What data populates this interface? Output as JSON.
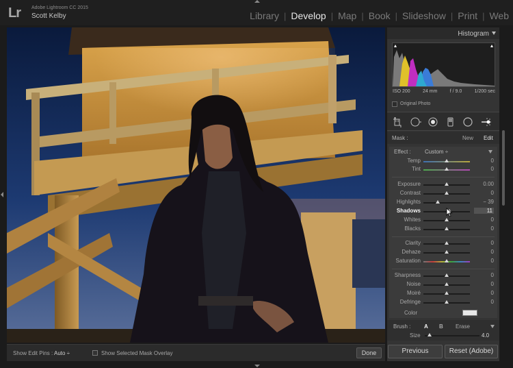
{
  "app": {
    "logo": "Lr",
    "name": "Adobe Lightroom CC 2015",
    "user": "Scott Kelby"
  },
  "modules": [
    {
      "label": "Library",
      "active": false
    },
    {
      "label": "Develop",
      "active": true
    },
    {
      "label": "Map",
      "active": false
    },
    {
      "label": "Book",
      "active": false
    },
    {
      "label": "Slideshow",
      "active": false
    },
    {
      "label": "Print",
      "active": false
    },
    {
      "label": "Web",
      "active": false
    }
  ],
  "histogram": {
    "title": "Histogram",
    "iso": "ISO 200",
    "focal": "24 mm",
    "aperture": "f / 9.0",
    "shutter": "1/200 sec",
    "original_photo": "Original Photo"
  },
  "tools": [
    "crop-icon",
    "spot-removal-icon",
    "red-eye-icon",
    "graduated-filter-icon",
    "radial-filter-icon",
    "adjustment-brush-icon"
  ],
  "mask": {
    "label": "Mask :",
    "new": "New",
    "edit": "Edit"
  },
  "effect": {
    "label": "Effect :",
    "value": "Custom ÷"
  },
  "sliders": {
    "temp": {
      "label": "Temp",
      "value": "0"
    },
    "tint": {
      "label": "Tint",
      "value": "0"
    },
    "exposure": {
      "label": "Exposure",
      "value": "0.00"
    },
    "contrast": {
      "label": "Contrast",
      "value": "0"
    },
    "highlights": {
      "label": "Highlights",
      "value": "− 39"
    },
    "shadows": {
      "label": "Shadows",
      "value": "11"
    },
    "whites": {
      "label": "Whites",
      "value": "0"
    },
    "blacks": {
      "label": "Blacks",
      "value": "0"
    },
    "clarity": {
      "label": "Clarity",
      "value": "0"
    },
    "dehaze": {
      "label": "Dehaze",
      "value": "0"
    },
    "saturation": {
      "label": "Saturation",
      "value": "0"
    },
    "sharpness": {
      "label": "Sharpness",
      "value": "0"
    },
    "noise": {
      "label": "Noise",
      "value": "0"
    },
    "moire": {
      "label": "Moiré",
      "value": "0"
    },
    "defringe": {
      "label": "Defringe",
      "value": "0"
    }
  },
  "color": {
    "label": "Color"
  },
  "brush": {
    "label": "Brush :",
    "a": "A",
    "b": "B",
    "erase": "Erase",
    "size_label": "Size",
    "size_value": "4.0"
  },
  "toolbar": {
    "pins_label": "Show Edit Pins :",
    "pins_value": "Auto ÷",
    "overlay_label": "Show Selected Mask Overlay",
    "done": "Done"
  },
  "buttons": {
    "previous": "Previous",
    "reset": "Reset (Adobe)"
  },
  "colors": {
    "accent": "#e8e8e8",
    "panel": "#343434",
    "background": "#1b1b1b"
  }
}
